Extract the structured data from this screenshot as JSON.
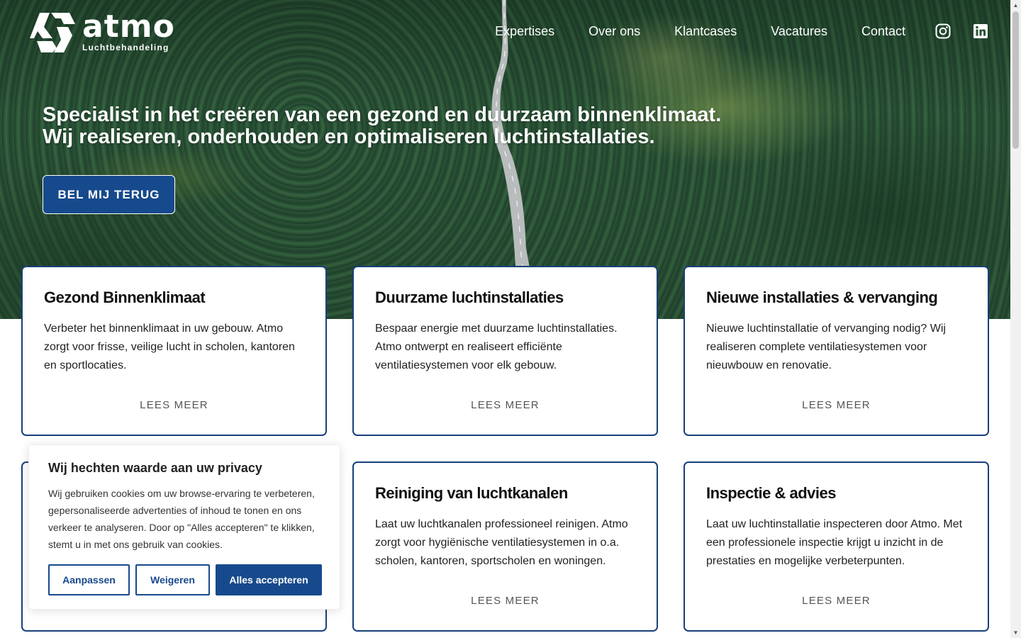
{
  "brand": {
    "name": "atmo",
    "tagline": "Luchtbehandeling"
  },
  "nav": {
    "items": [
      "Expertises",
      "Over ons",
      "Klantcases",
      "Vacatures",
      "Contact"
    ],
    "social": [
      "instagram-icon",
      "linkedin-icon"
    ]
  },
  "hero": {
    "line1": "Specialist in het creëren van een gezond en duurzaam binnenklimaat.",
    "line2": "Wij realiseren, onderhouden en optimaliseren luchtinstallaties.",
    "cta": "BEL MIJ TERUG"
  },
  "cards": [
    {
      "title": "Gezond Binnenklimaat",
      "text": "Verbeter het binnenklimaat in uw gebouw. Atmo zorgt voor frisse, veilige lucht in scholen, kantoren en sportlocaties.",
      "link": "LEES MEER"
    },
    {
      "title": "Duurzame luchtinstallaties",
      "text": "Bespaar energie met duurzame luchtinstallaties. Atmo ontwerpt en realiseert efficiënte ventilatiesystemen voor elk gebouw.",
      "link": "LEES MEER"
    },
    {
      "title": "Nieuwe installaties & vervanging",
      "text": "Nieuwe luchtinstallatie of vervanging nodig? Wij realiseren complete ventilatiesystemen voor nieuwbouw en renovatie.",
      "link": "LEES MEER"
    },
    {
      "title": "",
      "text": "",
      "link": ""
    },
    {
      "title": "Reiniging van luchtkanalen",
      "text": "Laat uw luchtkanalen professioneel reinigen. Atmo zorgt voor hygiënische ventilatiesystemen in o.a. scholen, kantoren, sportscholen en woningen.",
      "link": "LEES MEER"
    },
    {
      "title": "Inspectie & advies",
      "text": "Laat uw luchtinstallatie inspecteren door Atmo. Met een professionele inspectie krijgt u inzicht in de prestaties en mogelijke verbeterpunten.",
      "link": "LEES MEER"
    }
  ],
  "cookie": {
    "title": "Wij hechten waarde aan uw privacy",
    "text": "Wij gebruiken cookies om uw browse-ervaring te verbeteren, gepersonaliseerde advertenties of inhoud te tonen en ons verkeer te analyseren. Door op \"Alles accepteren\" te klikken, stemt u in met ons gebruik van cookies.",
    "buttons": {
      "customize": "Aanpassen",
      "reject": "Weigeren",
      "accept": "Alles accepteren"
    }
  },
  "colors": {
    "brand_blue": "#174a8c",
    "card_border": "#17407a"
  }
}
